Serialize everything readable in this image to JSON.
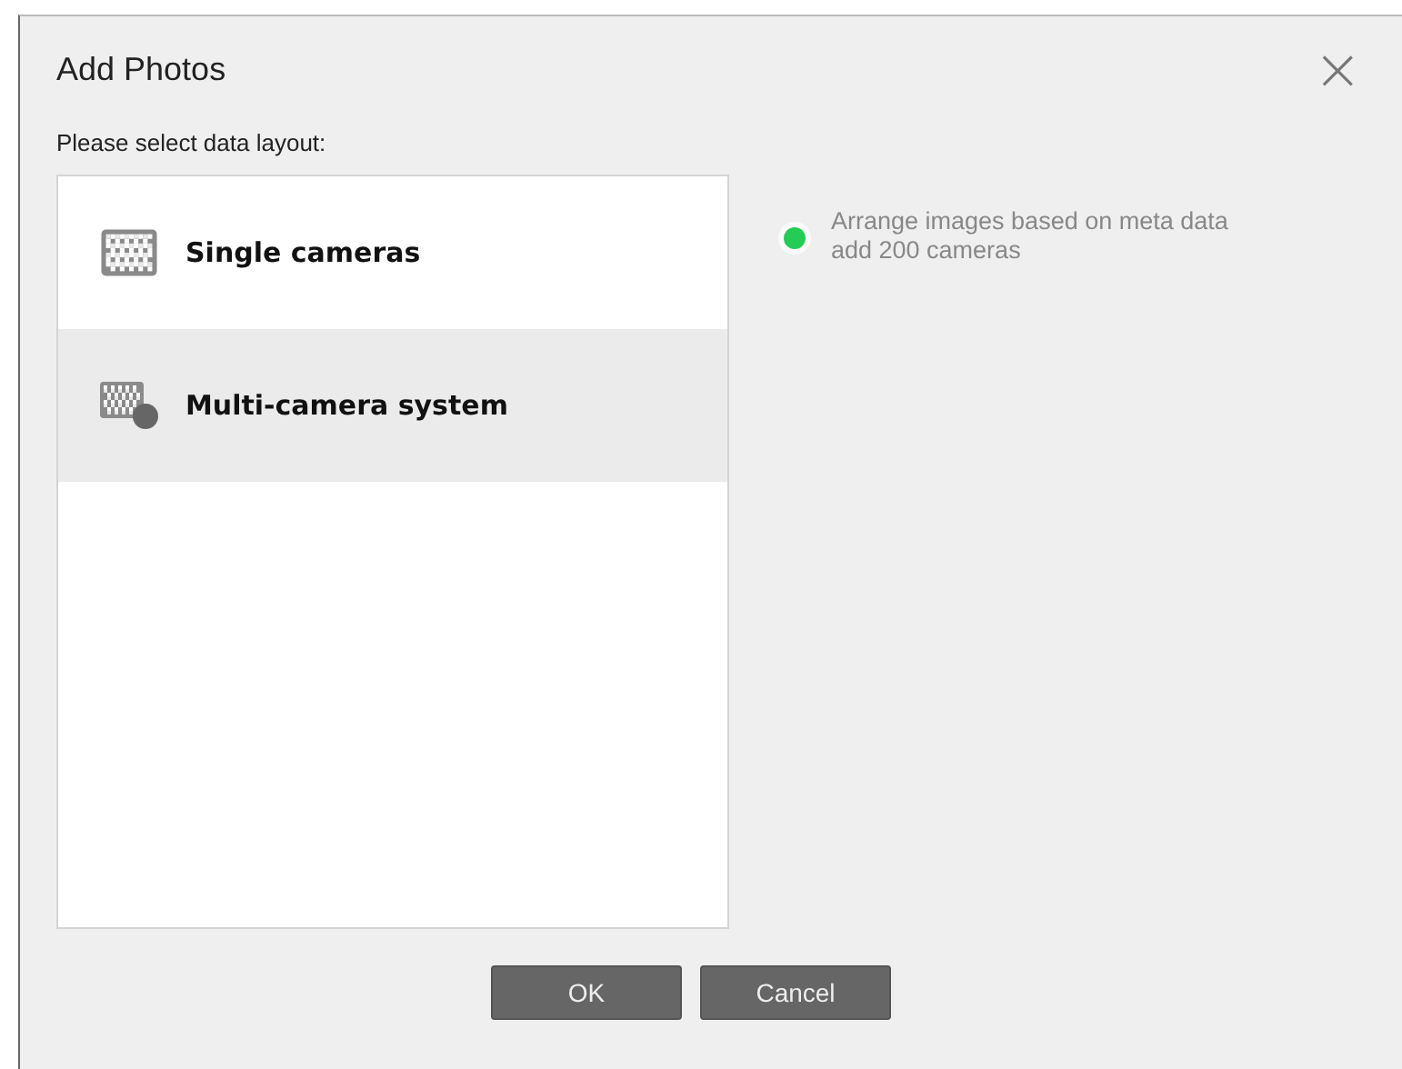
{
  "window": {
    "title": "Add Photos",
    "close": "×"
  },
  "prompt": "Please select data layout:",
  "layouts": [
    {
      "label": "Single cameras",
      "kind": "single",
      "selected": false
    },
    {
      "label": "Multi-camera system",
      "kind": "multi",
      "selected": true
    }
  ],
  "info": {
    "lines": [
      "Arrange images based on meta data",
      "add 200 cameras"
    ]
  },
  "buttons": [
    "OK",
    "Cancel"
  ]
}
